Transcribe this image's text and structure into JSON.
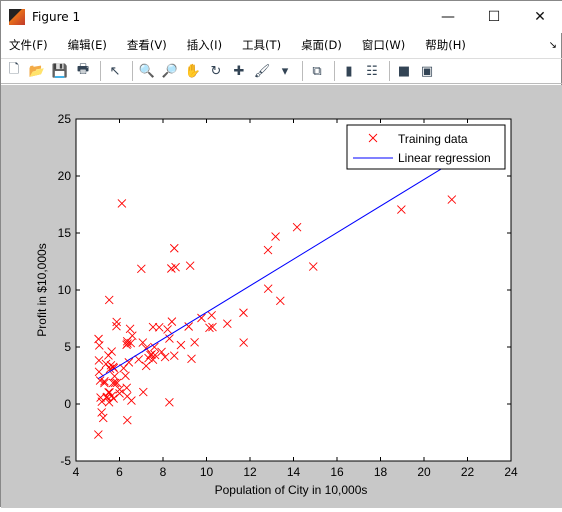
{
  "window": {
    "title": "Figure 1",
    "minimize": "—",
    "maximize": "☐",
    "close": "✕"
  },
  "menu": [
    "文件(F)",
    "编辑(E)",
    "查看(V)",
    "插入(I)",
    "工具(T)",
    "桌面(D)",
    "窗口(W)",
    "帮助(H)"
  ],
  "menu_arrow": "↘",
  "toolbar": [
    {
      "icon": "new-figure-icon",
      "glyph": "🗋"
    },
    {
      "icon": "open-icon",
      "glyph": "📂"
    },
    {
      "icon": "save-icon",
      "glyph": "💾"
    },
    {
      "icon": "print-icon",
      "glyph": "🖶"
    },
    {
      "sep": true
    },
    {
      "icon": "pointer-icon",
      "glyph": "↖"
    },
    {
      "sep": true
    },
    {
      "icon": "zoom-in-icon",
      "glyph": "🔍"
    },
    {
      "icon": "zoom-out-icon",
      "glyph": "🔎"
    },
    {
      "icon": "pan-icon",
      "glyph": "✋"
    },
    {
      "icon": "rotate-icon",
      "glyph": "↻"
    },
    {
      "icon": "data-cursor-icon",
      "glyph": "✚"
    },
    {
      "icon": "brush-icon",
      "glyph": "🖌"
    },
    {
      "icon": "dropdown-icon",
      "glyph": "▾"
    },
    {
      "sep": true
    },
    {
      "icon": "link-icon",
      "glyph": "⧉"
    },
    {
      "sep": true
    },
    {
      "icon": "colorbar-icon",
      "glyph": "▮"
    },
    {
      "icon": "legend-icon",
      "glyph": "☷"
    },
    {
      "sep": true
    },
    {
      "icon": "hide-tools-icon",
      "glyph": "■"
    },
    {
      "icon": "show-tools-icon",
      "glyph": "▣"
    }
  ],
  "chart_data": {
    "type": "scatter",
    "xlabel": "Population of City in 10,000s",
    "ylabel": "Profit in $10,000s",
    "xlim": [
      4,
      24
    ],
    "ylim": [
      -5,
      25
    ],
    "xticks": [
      4,
      6,
      8,
      10,
      12,
      14,
      16,
      18,
      20,
      22,
      24
    ],
    "yticks": [
      -5,
      0,
      5,
      10,
      15,
      20,
      25
    ],
    "grid": false,
    "legend_position": "top-right",
    "series": [
      {
        "name": "Training data",
        "type": "scatter",
        "marker": "x",
        "color": "#ff0000",
        "x": [
          6.1101,
          5.5277,
          8.5186,
          7.0032,
          5.8598,
          8.3829,
          7.4764,
          8.5781,
          6.4862,
          5.0546,
          5.7107,
          14.164,
          5.734,
          8.4084,
          5.6407,
          5.3794,
          6.3654,
          5.1301,
          6.4296,
          7.0708,
          6.1891,
          20.27,
          5.4901,
          6.3261,
          5.5649,
          18.945,
          12.828,
          10.957,
          13.176,
          22.203,
          5.2524,
          6.5894,
          9.2482,
          5.8918,
          8.2111,
          7.9334,
          8.0959,
          5.6063,
          12.836,
          6.3534,
          5.4069,
          6.8825,
          11.708,
          5.7737,
          7.8247,
          7.0931,
          5.0702,
          5.8014,
          11.7,
          5.5416,
          7.5402,
          5.3077,
          7.4239,
          7.6031,
          6.3328,
          6.3589,
          6.2742,
          5.6397,
          9.3102,
          9.4536,
          8.8254,
          5.1793,
          21.279,
          14.908,
          18.959,
          7.2182,
          8.2951,
          10.236,
          5.4994,
          20.341,
          10.136,
          7.3345,
          6.0062,
          7.2259,
          5.0269,
          6.5479,
          7.5386,
          5.0365,
          10.274,
          5.1077,
          5.7292,
          5.1884,
          6.3557,
          9.7687,
          6.5159,
          8.5172,
          9.1802,
          6.002,
          5.5204,
          5.0594,
          5.7077,
          7.6366,
          5.8707,
          5.3054,
          8.2934,
          13.394,
          5.4369
        ],
        "y": [
          17.592,
          9.1302,
          13.662,
          11.854,
          6.8233,
          11.886,
          4.3483,
          12,
          6.5987,
          3.8166,
          3.2522,
          15.505,
          3.1551,
          7.2258,
          0.71618,
          3.5129,
          5.3048,
          0.56077,
          3.6518,
          5.3893,
          3.1386,
          21.767,
          4.263,
          5.1875,
          3.0825,
          22.638,
          13.501,
          7.0467,
          14.692,
          24.147,
          -1.22,
          5.9966,
          12.134,
          1.8495,
          6.5426,
          4.5623,
          4.1164,
          3.3928,
          10.117,
          5.4974,
          0.55657,
          3.9115,
          5.3854,
          2.4406,
          6.7318,
          1.0463,
          5.1337,
          1.844,
          8.0043,
          1.0179,
          6.7504,
          1.8396,
          4.2885,
          4.9981,
          1.4233,
          -1.4211,
          2.4756,
          4.6042,
          3.9624,
          5.4141,
          5.1694,
          -0.74279,
          17.929,
          12.054,
          17.054,
          4.8852,
          5.7442,
          7.7754,
          1.0173,
          20.992,
          6.6799,
          4.0259,
          1.2784,
          3.3411,
          -2.6807,
          0.29678,
          3.8845,
          5.7014,
          6.7526,
          2.0576,
          0.47953,
          0.20421,
          0.67861,
          7.5435,
          5.3436,
          4.2415,
          6.7981,
          0.92695,
          0.152,
          2.8214,
          1.8451,
          4.2959,
          7.2029,
          1.9869,
          0.14454,
          9.0551,
          0.61705
        ]
      },
      {
        "name": "Linear regression",
        "type": "line",
        "color": "#0000ff",
        "x": [
          5.0269,
          22.203
        ],
        "y": [
          2.233,
          22.267
        ]
      }
    ]
  }
}
